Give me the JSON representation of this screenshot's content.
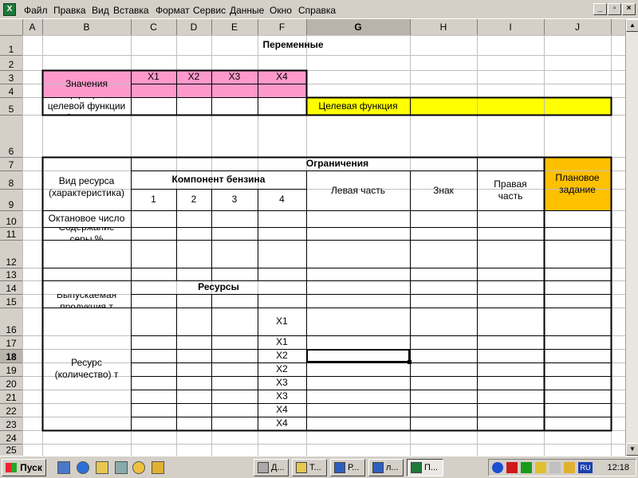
{
  "menu": {
    "app_icon": "X",
    "items": [
      "Файл",
      "Правка",
      "Вид",
      "Вставка",
      "Формат",
      "Сервис",
      "Данные",
      "Окно",
      "Справка"
    ],
    "win_min": "_",
    "win_restore": "▫",
    "win_close": "×"
  },
  "columns": [
    "A",
    "B",
    "C",
    "D",
    "E",
    "F",
    "G",
    "H",
    "I",
    "J"
  ],
  "rows": [
    "1",
    "2",
    "3",
    "4",
    "5",
    "6",
    "7",
    "8",
    "9",
    "10",
    "11",
    "12",
    "13",
    "14",
    "15",
    "16",
    "17",
    "18",
    "19",
    "20",
    "21",
    "22",
    "23",
    "24",
    "25"
  ],
  "active_row": "18",
  "colors": {
    "pink": "#ff99cc",
    "yellow": "#ffff00",
    "orange": "#ffc000"
  },
  "cells": {
    "variables_title": "Переменные",
    "values_label": "Значения",
    "x1": "X1",
    "x2": "X2",
    "x3": "X3",
    "x4": "X4",
    "coef_label": "Коэффициенты\nцелевой функции\n(себестоимость",
    "target_function": "Целевая функция",
    "constraints_title": "Ограничения",
    "plan_task": "Плановое\nзадание",
    "resource_kind": "Вид ресурса\n(характеристика)",
    "gasoline_component": "Компонент бензина",
    "left_part": "Левая часть",
    "sign": "Знак",
    "right_part": "Правая\nчасть",
    "c1": "1",
    "c2": "2",
    "c3": "3",
    "c4": "4",
    "octane": "Октановое число",
    "sulfur": "Содержание\nсеры %",
    "resources_title": "Ресурсы",
    "output_product": "Выпускаемая\nпродукция т",
    "resource_qty": "Ресурс\n(количество) т",
    "r16": "X1",
    "r17": "X1",
    "r18": "X2",
    "r19": "X2",
    "r20": "X3",
    "r21": "X3",
    "r22": "X4",
    "r23": "X4"
  },
  "taskbar": {
    "start_label": "Пуск",
    "tasks": [
      "Д...",
      "Т...",
      "Р...",
      "л...",
      "П..."
    ],
    "clock": "12:18",
    "lang": "RU"
  },
  "quick_launch_icons": [
    "show-desktop-icon",
    "ie-icon",
    "folder-icon",
    "mycomputer-icon",
    "clock-icon",
    "pencil-icon"
  ],
  "tray_icons": [
    "help-icon",
    "k-icon",
    "green-icon",
    "pencil-icon",
    "speaker-icon",
    "monitor-icon"
  ]
}
